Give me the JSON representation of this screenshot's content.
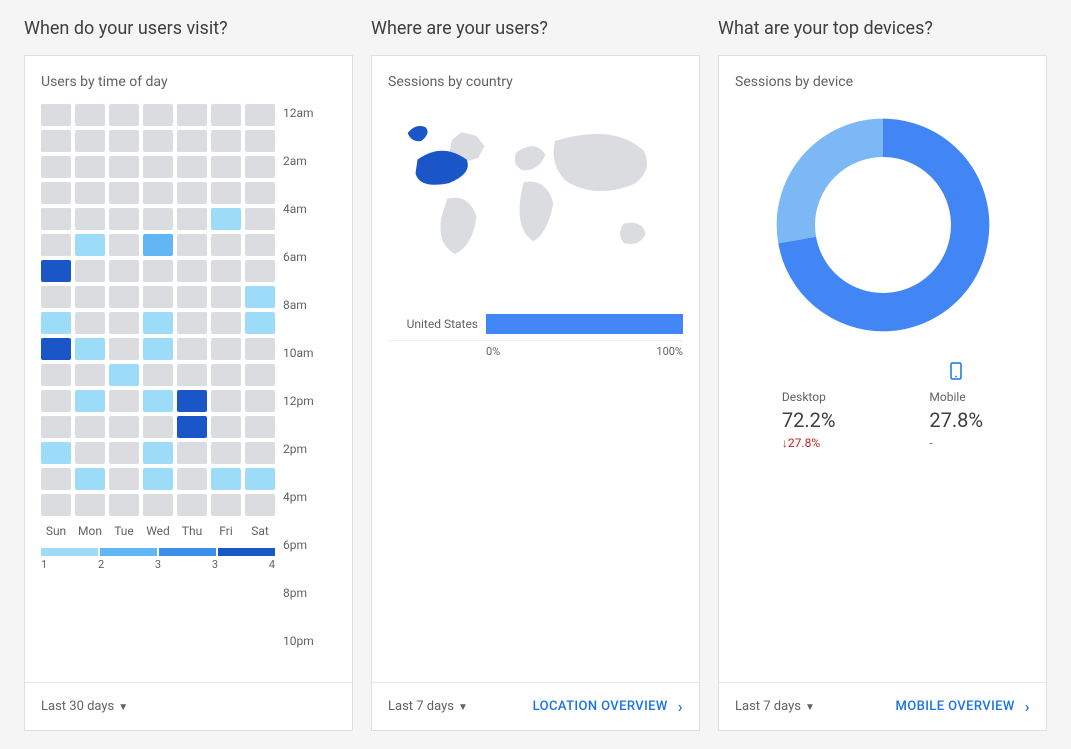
{
  "sections": {
    "visit": {
      "title": "When do your users visit?",
      "subtitle": "Users by time of day",
      "footer_range": "Last 30 days"
    },
    "where": {
      "title": "Where are your users?",
      "subtitle": "Sessions by country",
      "footer_range": "Last 7 days",
      "footer_link": "LOCATION OVERVIEW"
    },
    "devices": {
      "title": "What are your top devices?",
      "subtitle": "Sessions by device",
      "footer_range": "Last 7 days",
      "footer_link": "MOBILE OVERVIEW"
    }
  },
  "chart_data": {
    "heatmap": {
      "type": "heatmap",
      "title": "Users by time of day",
      "days": [
        "Sun",
        "Mon",
        "Tue",
        "Wed",
        "Thu",
        "Fri",
        "Sat"
      ],
      "time_labels": [
        "12am",
        "2am",
        "4am",
        "6am",
        "8am",
        "10am",
        "12pm",
        "2pm",
        "4pm",
        "6pm",
        "8pm",
        "10pm"
      ],
      "legend": {
        "values": [
          1,
          2,
          3,
          3,
          4
        ],
        "ticks": [
          "1",
          "2",
          "3",
          "3",
          "4"
        ]
      },
      "grid": [
        [
          0,
          0,
          0,
          0,
          0,
          0,
          0
        ],
        [
          0,
          0,
          0,
          0,
          0,
          0,
          0
        ],
        [
          0,
          0,
          0,
          0,
          0,
          0,
          0
        ],
        [
          0,
          0,
          0,
          0,
          0,
          0,
          0
        ],
        [
          0,
          0,
          0,
          0,
          0,
          1,
          0
        ],
        [
          0,
          1,
          0,
          2,
          0,
          0,
          0
        ],
        [
          4,
          0,
          0,
          0,
          0,
          0,
          0
        ],
        [
          0,
          0,
          0,
          0,
          0,
          0,
          1
        ],
        [
          1,
          0,
          0,
          1,
          0,
          0,
          1
        ],
        [
          4,
          1,
          0,
          1,
          0,
          0,
          0
        ],
        [
          0,
          0,
          1,
          0,
          0,
          0,
          0
        ],
        [
          0,
          1,
          0,
          1,
          4,
          0,
          0
        ],
        [
          0,
          0,
          0,
          0,
          4,
          0,
          0
        ],
        [
          1,
          0,
          0,
          1,
          0,
          0,
          0
        ],
        [
          0,
          1,
          0,
          1,
          0,
          1,
          1
        ],
        [
          0,
          0,
          0,
          0,
          0,
          0,
          0
        ]
      ],
      "palette": {
        "0": "#dadce0",
        "1": "#9ddcf9",
        "2": "#62b6f4",
        "3": "#3b8eea",
        "4": "#1a56c7"
      }
    },
    "country_bar": {
      "type": "bar",
      "title": "Sessions by country",
      "categories": [
        "United States"
      ],
      "values": [
        100
      ],
      "xlabel": "",
      "ylabel": "",
      "xmin": 0,
      "xmax": 100,
      "axis_ticks": [
        "0%",
        "100%"
      ]
    },
    "device_donut": {
      "type": "pie",
      "title": "Sessions by device",
      "series": [
        {
          "name": "Desktop",
          "value": 72.2,
          "color": "#4285f4",
          "delta_pct": -27.8,
          "delta_label": "27.8%"
        },
        {
          "name": "Mobile",
          "value": 27.8,
          "color": "#7bb8f5",
          "delta_pct": null,
          "delta_label": "-"
        }
      ]
    }
  }
}
